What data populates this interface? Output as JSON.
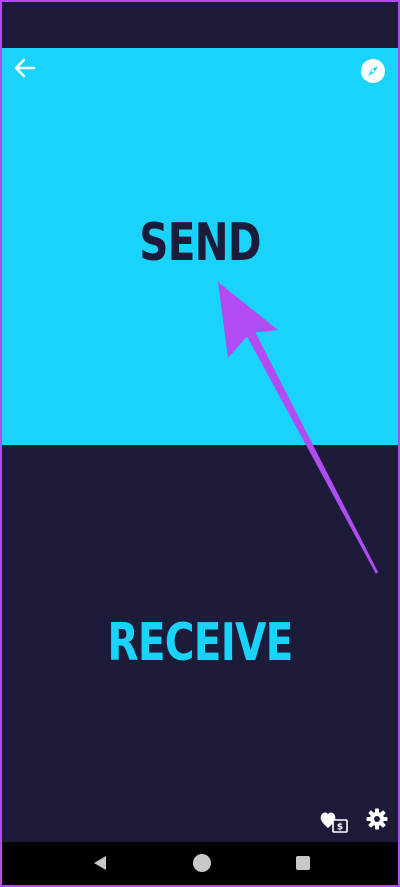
{
  "app": {
    "send_label": "SEND",
    "receive_label": "RECEIVE"
  },
  "icons": {
    "back": "arrow-left-icon",
    "compass": "compass-icon",
    "tip": "heart-dollar-icon",
    "settings": "gear-icon"
  },
  "nav": {
    "back": "triangle-back-icon",
    "home": "circle-home-icon",
    "recents": "square-recents-icon"
  },
  "colors": {
    "send_panel": "#1ad3fb",
    "receive_panel": "#1c1c3a",
    "annotation_arrow": "#b04cf2",
    "frame_border": "#b04cf2"
  }
}
